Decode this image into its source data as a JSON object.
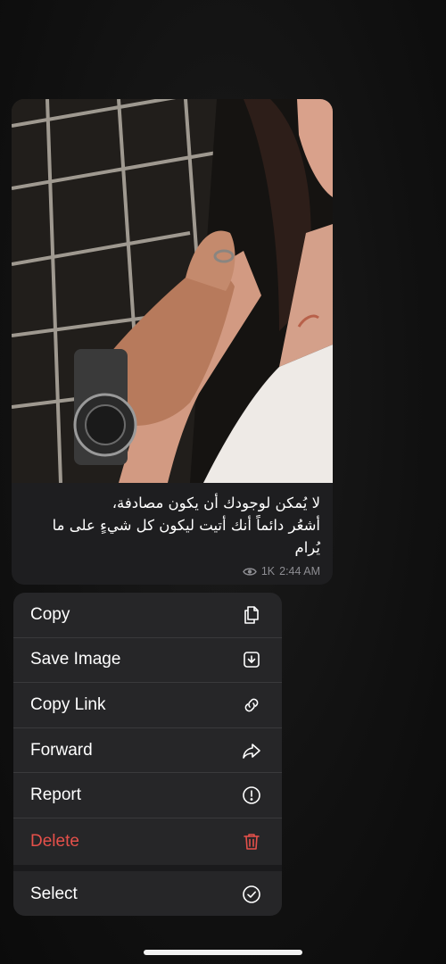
{
  "message": {
    "caption_lines": [
      "لا يُمكن لوجودك أن يكون مصادفة،",
      "أشعُر دائماً أنك أتيت ليكون كل شيءٍ على ما",
      "يُرام"
    ],
    "views": "1K",
    "time": "2:44 AM",
    "photo_icon": "couple-holding-hands-photo"
  },
  "menu": {
    "items": [
      {
        "label": "Copy",
        "icon": "copy-icon"
      },
      {
        "label": "Save Image",
        "icon": "save-image-icon"
      },
      {
        "label": "Copy Link",
        "icon": "link-icon"
      },
      {
        "label": "Forward",
        "icon": "forward-icon"
      },
      {
        "label": "Report",
        "icon": "report-icon"
      },
      {
        "label": "Delete",
        "icon": "trash-icon",
        "color": "#e5504a"
      }
    ],
    "select": {
      "label": "Select",
      "icon": "checkmark-circle-icon"
    }
  },
  "colors": {
    "menu_background": "#262628",
    "danger": "#e5504a",
    "meta_text": "#8d8d92"
  }
}
